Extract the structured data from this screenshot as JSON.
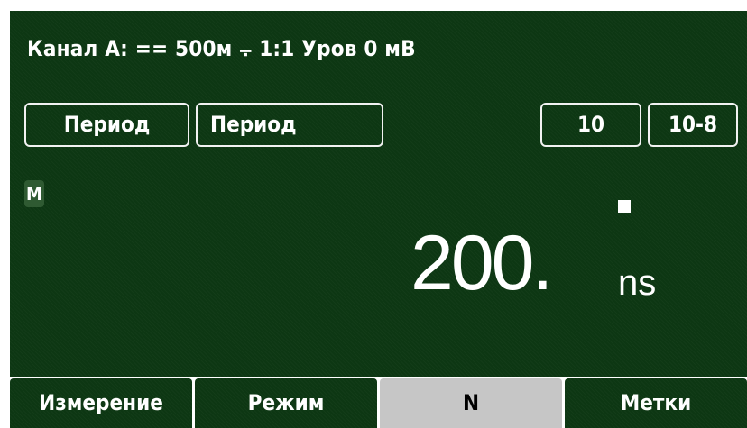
{
  "status_line": {
    "channel_label": "Канал А:",
    "coupling_symbol": "==",
    "impedance": "500м",
    "trigger_symbol": "⨪",
    "attenuation": "1:1",
    "level": "Уров 0 мВ"
  },
  "fields": {
    "measurement_left": "Период",
    "measurement_right": "Период",
    "gate_value": "10",
    "resolution_value": "10-8"
  },
  "mode_flag": "M",
  "reading": {
    "value": "200.",
    "unit": "ns"
  },
  "softkeys": [
    {
      "label": "Измерение",
      "active": false
    },
    {
      "label": "Режим",
      "active": false
    },
    {
      "label": "N",
      "active": true
    },
    {
      "label": "Метки",
      "active": false
    }
  ],
  "colors": {
    "screen_background": "#0d3713",
    "active_softkey": "#c6c6c6",
    "text": "#ffffff"
  }
}
